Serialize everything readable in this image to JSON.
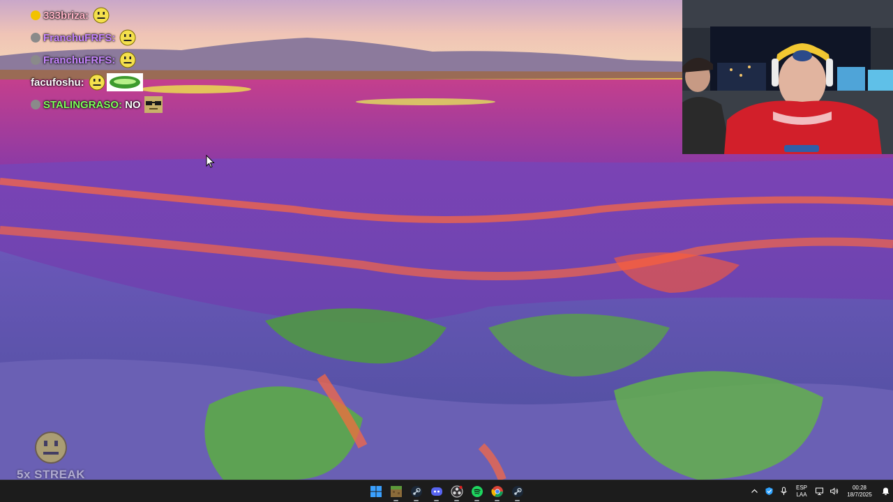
{
  "chat": {
    "messages": [
      {
        "user": "333briza:",
        "message": "",
        "user_color": "#ffb3c6",
        "badge_color": "#f2c200",
        "emote": "smile-emote"
      },
      {
        "user": "FranchuFRFS:",
        "message": "",
        "user_color": "#c685ff",
        "badge_color": "#8a8a8a",
        "emote": "smile-emote"
      },
      {
        "user": "FranchuFRFS:",
        "message": "",
        "user_color": "#c685ff",
        "badge_color": "#8a8a8a",
        "emote": "smile-emote"
      },
      {
        "user": "facufoshu:",
        "message": "",
        "user_color": "#ffffff",
        "badge_color": "",
        "emote": "smile-emote"
      },
      {
        "user": "STALINGRASO:",
        "message": "NO",
        "user_color": "#7dff5a",
        "badge_color": "#8a8a8a",
        "emote": "glasses-emote"
      }
    ]
  },
  "streak": {
    "label": "5x STREAK",
    "icon": "smile-emote"
  },
  "taskbar": {
    "apps": [
      {
        "name": "start-button",
        "icon": "windows-icon"
      },
      {
        "name": "minecraft-button",
        "icon": "minecraft-icon"
      },
      {
        "name": "steam-button",
        "icon": "steam-icon"
      },
      {
        "name": "discord-button",
        "icon": "discord-icon"
      },
      {
        "name": "obs-button",
        "icon": "obs-icon"
      },
      {
        "name": "spotify-button",
        "icon": "spotify-icon"
      },
      {
        "name": "chrome-button",
        "icon": "chrome-icon"
      },
      {
        "name": "steam-button-2",
        "icon": "steam-icon"
      }
    ],
    "language": {
      "line1": "ESP",
      "line2": "LAA"
    },
    "clock": {
      "time": "00:28",
      "date": "18/7/2025"
    }
  },
  "colors": {
    "taskbar_bg": "#1c1c1c",
    "windows_blue": "#3aa0ff",
    "spotify_green": "#1ed760",
    "discord_blurple": "#5865f2"
  }
}
